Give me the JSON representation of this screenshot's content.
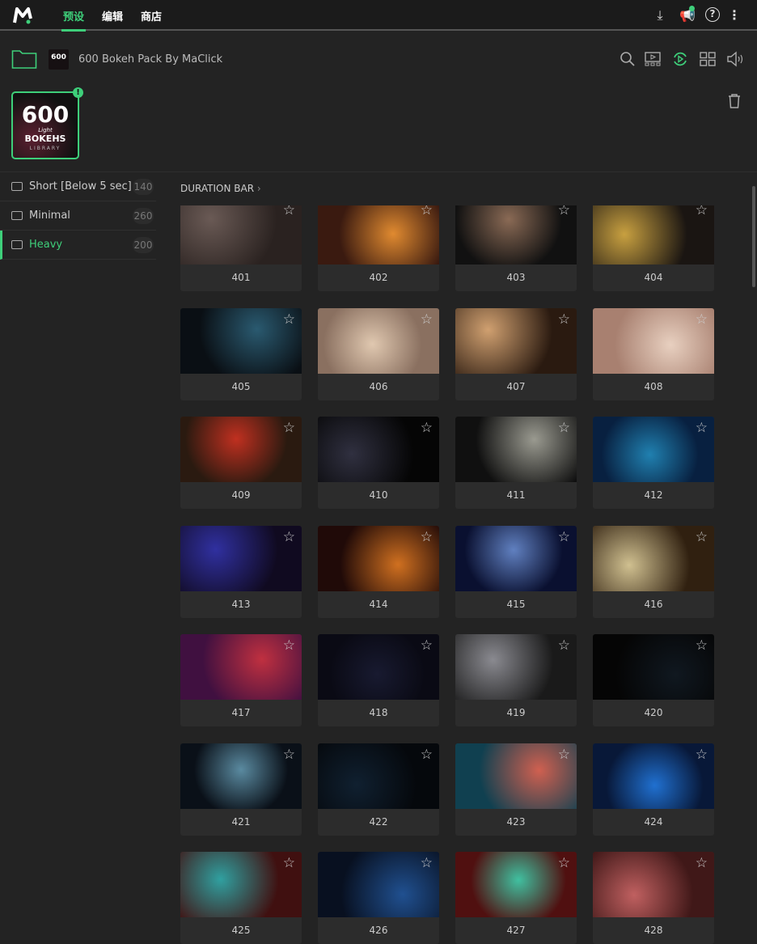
{
  "topbar": {
    "tabs": [
      "预设",
      "编辑",
      "商店"
    ],
    "icons": [
      "download-icon",
      "announcement-icon",
      "help-icon",
      "more-icon"
    ]
  },
  "pack": {
    "title": "600 Bokeh Pack By MaClick",
    "cover": {
      "number": "600",
      "script": "Light",
      "name": "BOKEHS",
      "sub": "LIBRARY"
    },
    "badge": "!"
  },
  "toolbar_icons": [
    "search-icon",
    "preview-icon",
    "autoplay-icon",
    "grid-icon",
    "volume-icon",
    "trash-icon"
  ],
  "sidebar": [
    {
      "label": "Short [Below 5 sec]",
      "count": "140"
    },
    {
      "label": "Minimal",
      "count": "260"
    },
    {
      "label": "Heavy",
      "count": "200",
      "active": true
    }
  ],
  "section": {
    "title": "DURATION BAR",
    "chevron": "›"
  },
  "accent": "#3ecf7a",
  "items": [
    {
      "label": "401",
      "c1": "#6a5a55",
      "c2": "#2a2220"
    },
    {
      "label": "402",
      "c1": "#e08a30",
      "c2": "#3a1a10"
    },
    {
      "label": "403",
      "c1": "#8a6a55",
      "c2": "#111111"
    },
    {
      "label": "404",
      "c1": "#c8a040",
      "c2": "#1a1512"
    },
    {
      "label": "405",
      "c1": "#2a5a70",
      "c2": "#0a0f14"
    },
    {
      "label": "406",
      "c1": "#e0c8b0",
      "c2": "#8a7060"
    },
    {
      "label": "407",
      "c1": "#d0a070",
      "c2": "#2a1a10"
    },
    {
      "label": "408",
      "c1": "#e8d0c0",
      "c2": "#a88070"
    },
    {
      "label": "409",
      "c1": "#c03020",
      "c2": "#2a1a10"
    },
    {
      "label": "410",
      "c1": "#303040",
      "c2": "#050505"
    },
    {
      "label": "411",
      "c1": "#9a9a90",
      "c2": "#101010"
    },
    {
      "label": "412",
      "c1": "#2080b0",
      "c2": "#082040"
    },
    {
      "label": "413",
      "c1": "#3030a0",
      "c2": "#100a20"
    },
    {
      "label": "414",
      "c1": "#d07020",
      "c2": "#200a08"
    },
    {
      "label": "415",
      "c1": "#6080c0",
      "c2": "#0a1030"
    },
    {
      "label": "416",
      "c1": "#d0c090",
      "c2": "#302010"
    },
    {
      "label": "417",
      "c1": "#c03040",
      "c2": "#401040"
    },
    {
      "label": "418",
      "c1": "#181a30",
      "c2": "#0a0a14"
    },
    {
      "label": "419",
      "c1": "#8a8a90",
      "c2": "#1a1a1a"
    },
    {
      "label": "420",
      "c1": "#101820",
      "c2": "#050505"
    },
    {
      "label": "421",
      "c1": "#5a8aa0",
      "c2": "#0a1018"
    },
    {
      "label": "422",
      "c1": "#102030",
      "c2": "#05080c"
    },
    {
      "label": "423",
      "c1": "#d06050",
      "c2": "#104050"
    },
    {
      "label": "424",
      "c1": "#2070d0",
      "c2": "#081838"
    },
    {
      "label": "425",
      "c1": "#30a0a0",
      "c2": "#401010"
    },
    {
      "label": "426",
      "c1": "#205090",
      "c2": "#081020"
    },
    {
      "label": "427",
      "c1": "#40c0a0",
      "c2": "#501010"
    },
    {
      "label": "428",
      "c1": "#c06060",
      "c2": "#401818"
    }
  ]
}
